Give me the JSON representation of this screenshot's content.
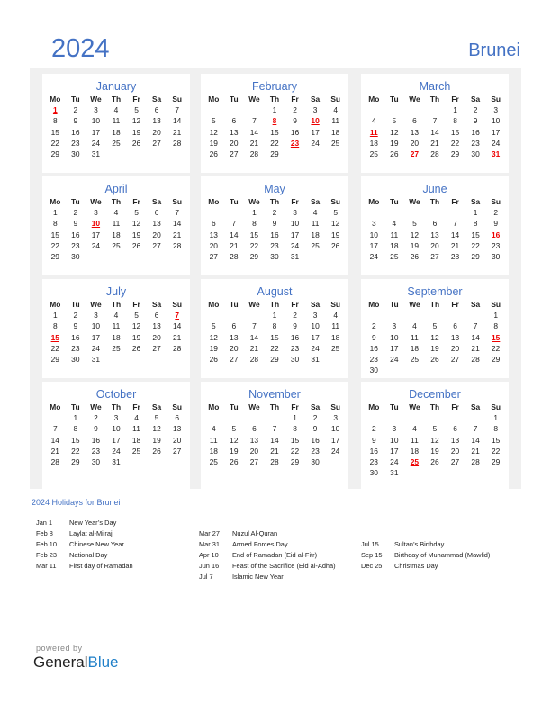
{
  "header": {
    "year": "2024",
    "country": "Brunei"
  },
  "weekdays": [
    "Mo",
    "Tu",
    "We",
    "Th",
    "Fr",
    "Sa",
    "Su"
  ],
  "months": [
    {
      "name": "January",
      "offset": 0,
      "days": 31,
      "holidays": [
        1
      ]
    },
    {
      "name": "February",
      "offset": 3,
      "days": 29,
      "holidays": [
        8,
        10,
        23
      ]
    },
    {
      "name": "March",
      "offset": 4,
      "days": 31,
      "holidays": [
        11,
        27,
        31
      ]
    },
    {
      "name": "April",
      "offset": 0,
      "days": 30,
      "holidays": [
        10
      ]
    },
    {
      "name": "May",
      "offset": 2,
      "days": 31,
      "holidays": []
    },
    {
      "name": "June",
      "offset": 5,
      "days": 30,
      "holidays": [
        16
      ]
    },
    {
      "name": "July",
      "offset": 0,
      "days": 31,
      "holidays": [
        7,
        15
      ]
    },
    {
      "name": "August",
      "offset": 3,
      "days": 31,
      "holidays": []
    },
    {
      "name": "September",
      "offset": 6,
      "days": 30,
      "holidays": [
        15
      ]
    },
    {
      "name": "October",
      "offset": 1,
      "days": 31,
      "holidays": []
    },
    {
      "name": "November",
      "offset": 4,
      "days": 30,
      "holidays": []
    },
    {
      "name": "December",
      "offset": 6,
      "days": 31,
      "holidays": [
        25
      ]
    }
  ],
  "holidays_title": "2024 Holidays for Brunei",
  "holiday_columns": [
    [
      {
        "date": "Jan 1",
        "name": "New Year’s Day"
      },
      {
        "date": "Feb 8",
        "name": "Laylat al-Mi’raj"
      },
      {
        "date": "Feb 10",
        "name": "Chinese New Year"
      },
      {
        "date": "Feb 23",
        "name": "National Day"
      },
      {
        "date": "Mar 11",
        "name": "First day of Ramadan"
      }
    ],
    [
      {
        "date": "Mar 27",
        "name": "Nuzul Al-Quran"
      },
      {
        "date": "Mar 31",
        "name": "Armed Forces Day"
      },
      {
        "date": "Apr 10",
        "name": "End of Ramadan (Eid al-Fitr)"
      },
      {
        "date": "Jun 16",
        "name": "Feast of the Sacrifice (Eid al-Adha)"
      },
      {
        "date": "Jul 7",
        "name": "Islamic New Year"
      }
    ],
    [
      {
        "date": "Jul 15",
        "name": "Sultan’s Birthday"
      },
      {
        "date": "Sep 15",
        "name": "Birthday of Muhammad (Mawlid)"
      },
      {
        "date": "Dec 25",
        "name": "Christmas Day"
      }
    ]
  ],
  "footer": {
    "powered_by": "powered by",
    "brand_part1": "General",
    "brand_part2": "Blue"
  }
}
